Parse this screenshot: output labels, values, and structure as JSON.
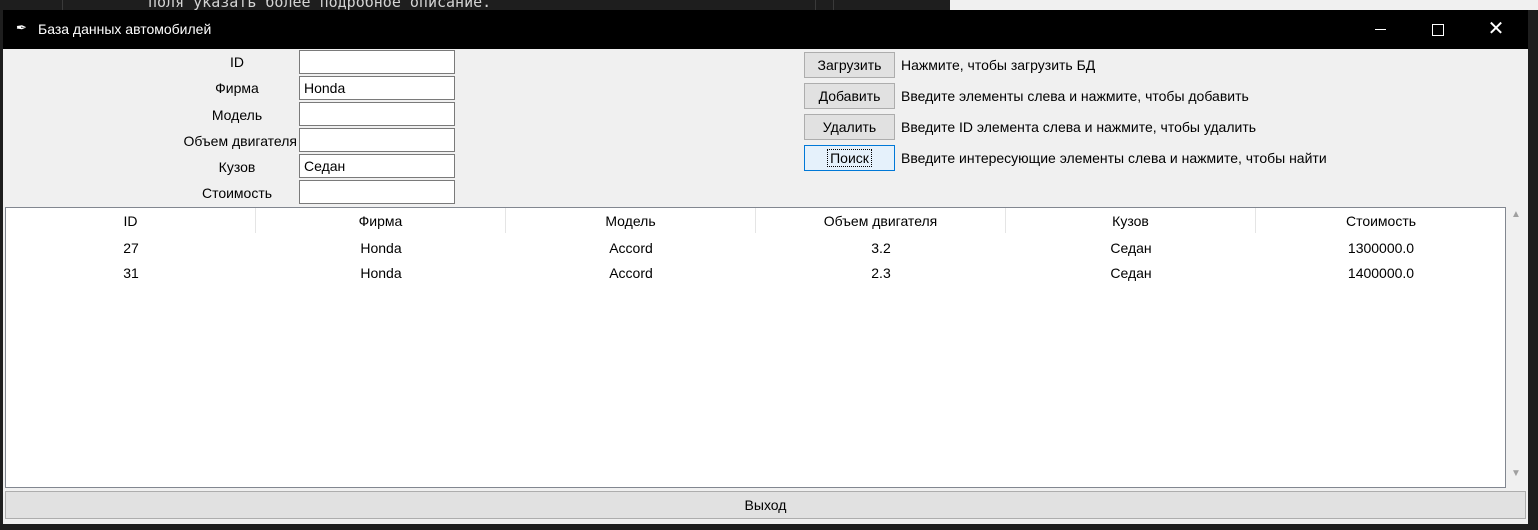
{
  "background": {
    "code_line": "поля указать более подробное описание."
  },
  "window": {
    "title": "База данных автомобилей",
    "icon": "feather-icon"
  },
  "form": {
    "fields": [
      {
        "label": "ID",
        "value": ""
      },
      {
        "label": "Фирма",
        "value": "Honda"
      },
      {
        "label": "Модель",
        "value": ""
      },
      {
        "label": "Объем двигателя",
        "value": ""
      },
      {
        "label": "Кузов",
        "value": "Седан"
      },
      {
        "label": "Стоимость",
        "value": ""
      }
    ]
  },
  "actions": [
    {
      "label": "Загрузить",
      "description": "Нажмите, чтобы загрузить БД"
    },
    {
      "label": "Добавить",
      "description": "Введите элементы слева и нажмите, чтобы добавить"
    },
    {
      "label": "Удалить",
      "description": "Введите ID элемента слева и нажмите, чтобы удалить"
    },
    {
      "label": "Поиск",
      "description": "Введите интересующие элементы слева и нажмите, чтобы найти"
    }
  ],
  "table": {
    "columns": [
      "ID",
      "Фирма",
      "Модель",
      "Объем двигателя",
      "Кузов",
      "Стоимость"
    ],
    "rows": [
      [
        "27",
        "Honda",
        "Accord",
        "3.2",
        "Седан",
        "1300000.0"
      ],
      [
        "31",
        "Honda",
        "Accord",
        "2.3",
        "Седан",
        "1400000.0"
      ]
    ]
  },
  "exit_label": "Выход",
  "colors": {
    "titlebar": "#000000",
    "window_bg": "#f0f0f0",
    "focus_accent": "#0078d7"
  }
}
